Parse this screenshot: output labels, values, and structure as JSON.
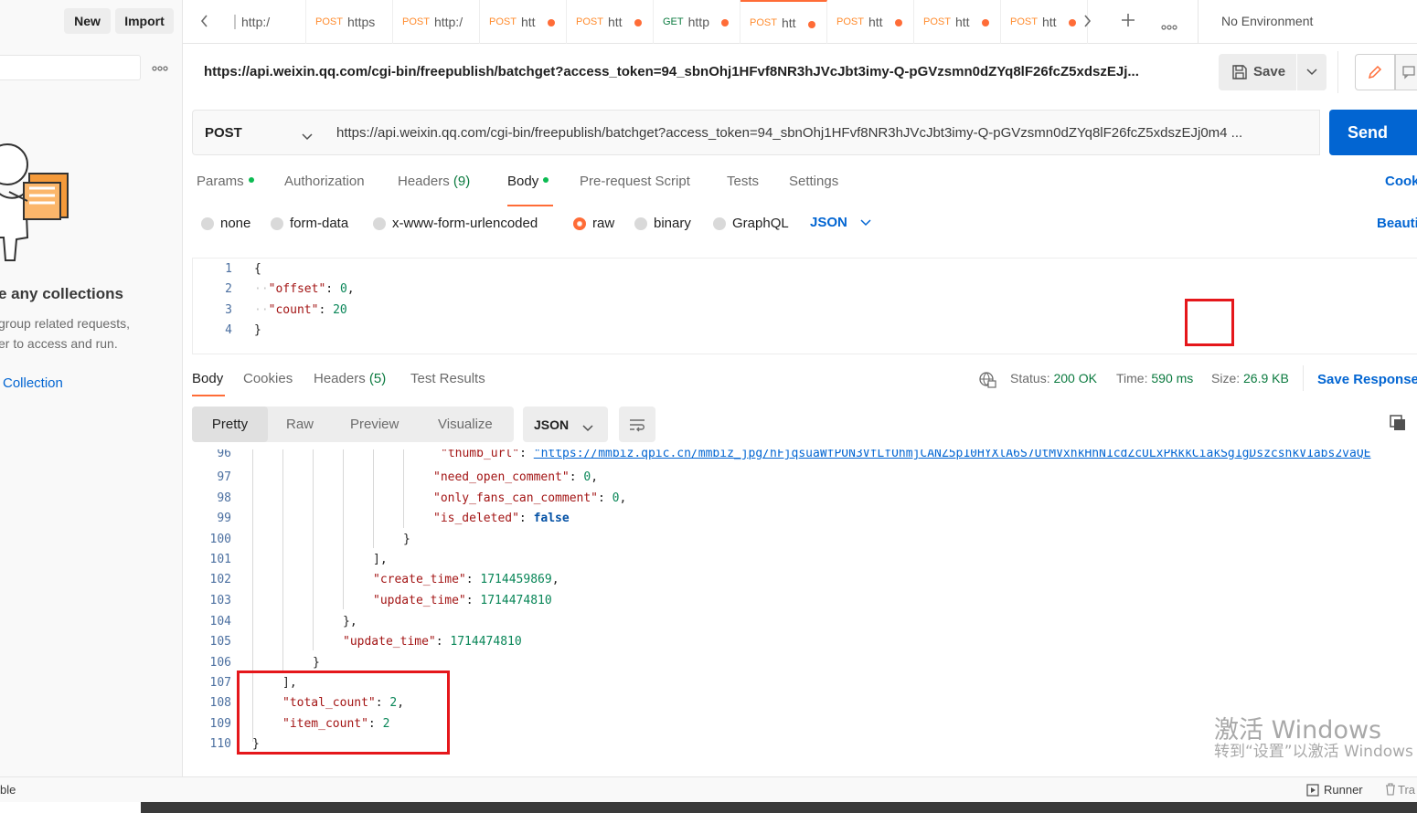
{
  "sidebar": {
    "new_label": "New",
    "import_label": "Import",
    "more_icon": "more-horizontal-icon",
    "empty_title": "e any collections",
    "empty_desc_line1": "group related requests,",
    "empty_desc_line2": "er to access and run.",
    "create_collection_label": "Collection"
  },
  "tabs": [
    {
      "method": "",
      "label": "http:/",
      "unsaved": false
    },
    {
      "method": "POST",
      "label": "https",
      "unsaved": false
    },
    {
      "method": "POST",
      "label": "http:/",
      "unsaved": false
    },
    {
      "method": "POST",
      "label": "htt",
      "unsaved": true
    },
    {
      "method": "POST",
      "label": "htt",
      "unsaved": true
    },
    {
      "method": "GET",
      "label": "http",
      "unsaved": true
    },
    {
      "method": "POST",
      "label": "htt",
      "unsaved": true,
      "active": true
    },
    {
      "method": "POST",
      "label": "htt",
      "unsaved": true
    },
    {
      "method": "POST",
      "label": "htt",
      "unsaved": true
    },
    {
      "method": "POST",
      "label": "htt",
      "unsaved": true
    }
  ],
  "environment": "No Environment",
  "request": {
    "header_url": "https://api.weixin.qq.com/cgi-bin/freepublish/batchget?access_token=94_sbnOhj1HFvf8NR3hJVcJbt3imy-Q-pGVzsmn0dZYq8lF26fcZ5xdszEJj...",
    "save_label": "Save",
    "method": "POST",
    "url": "https://api.weixin.qq.com/cgi-bin/freepublish/batchget?access_token=94_sbnOhj1HFvf8NR3hJVcJbt3imy-Q-pGVzsmn0dZYq8lF26fcZ5xdszEJj0m4 ...",
    "send_label": "Send",
    "tabs": {
      "params": "Params",
      "authorization": "Authorization",
      "headers": "Headers",
      "headers_count": "(9)",
      "body": "Body",
      "prerequest": "Pre-request Script",
      "tests": "Tests",
      "settings": "Settings",
      "cookies": "Cook"
    },
    "body_types": {
      "none": "none",
      "form_data": "form-data",
      "urlencoded": "x-www-form-urlencoded",
      "raw": "raw",
      "binary": "binary",
      "graphql": "GraphQL",
      "format": "JSON",
      "beautify": "Beauti"
    },
    "body_lines": [
      "1",
      "2",
      "3",
      "4"
    ]
  },
  "response": {
    "tabs": {
      "body": "Body",
      "cookies": "Cookies",
      "headers": "Headers",
      "headers_count": "(5)",
      "test_results": "Test Results"
    },
    "status_label": "Status:",
    "status_value": "200 OK",
    "time_label": "Time:",
    "time_value": "590 ms",
    "size_label": "Size:",
    "size_value": "26.9 KB",
    "save_response": "Save Response",
    "views": {
      "pretty": "Pretty",
      "raw": "Raw",
      "preview": "Preview",
      "visualize": "Visualize"
    },
    "format": "JSON",
    "line_numbers": [
      "96",
      "97",
      "98",
      "99",
      "100",
      "101",
      "102",
      "103",
      "104",
      "105",
      "106",
      "107",
      "108",
      "109",
      "110"
    ]
  },
  "statusbar": {
    "left": "ble",
    "runner": "Runner",
    "trash": "Tra"
  },
  "watermark": {
    "line1": "激活 Windows",
    "line2": "转到“设置”以激活 Windows"
  },
  "colors": {
    "accent": "#ff6c37",
    "primary": "#0265d2",
    "success": "#0b7a3f",
    "annotation_red": "#e5171b"
  }
}
